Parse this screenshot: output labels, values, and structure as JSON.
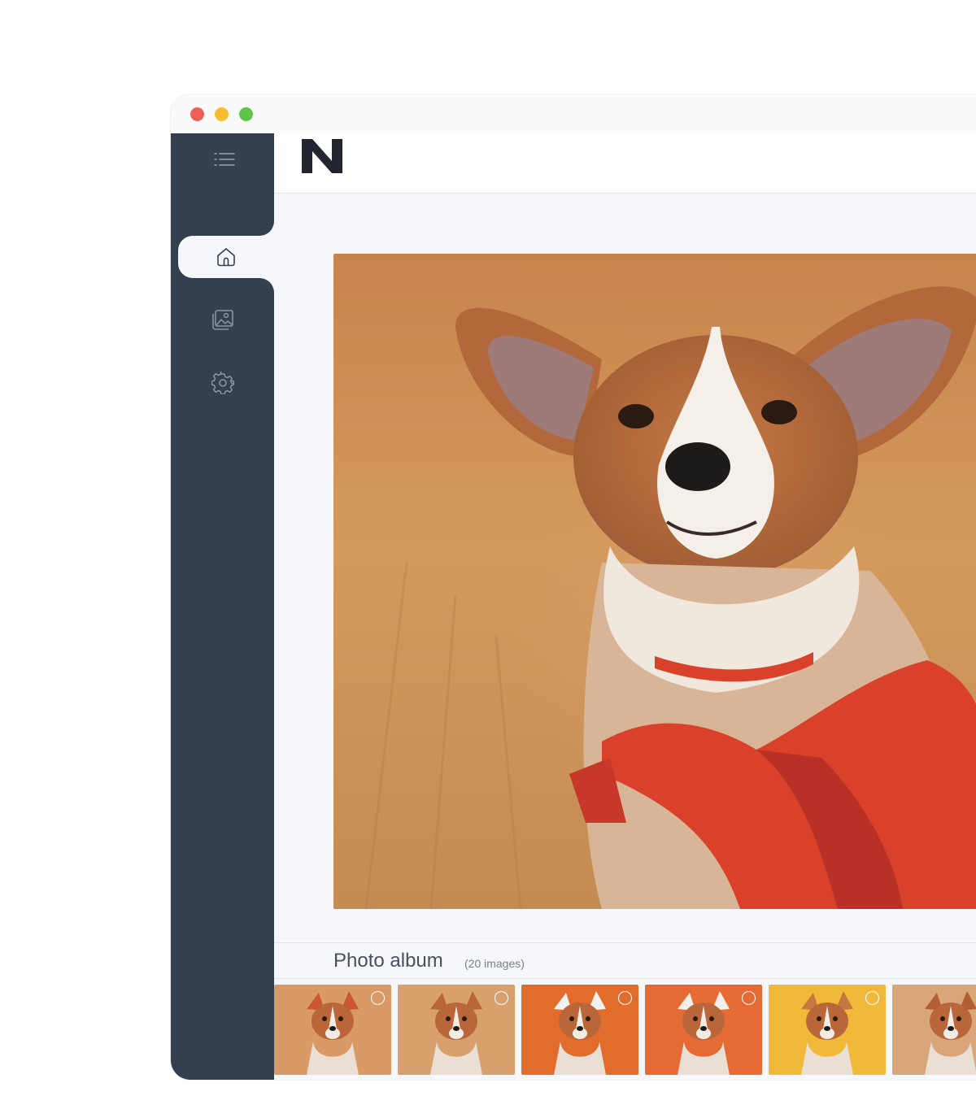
{
  "window": {
    "controls": [
      "close",
      "minimize",
      "maximize"
    ]
  },
  "sidebar": {
    "menu_icon": "list-menu-icon",
    "items": [
      {
        "id": "home",
        "icon": "home-icon",
        "active": true
      },
      {
        "id": "gallery",
        "icon": "gallery-icon",
        "active": false
      },
      {
        "id": "settings",
        "icon": "gear-icon",
        "active": false
      }
    ]
  },
  "header": {
    "logo": "n-logo"
  },
  "album": {
    "title": "Photo album",
    "count": "(20 images)",
    "thumbnails": [
      {
        "bg": "#d99a66",
        "accent": "#c9572f"
      },
      {
        "bg": "#d8a06c",
        "accent": "#b8653a"
      },
      {
        "bg": "#e16c2c",
        "accent": "#f2f1ef"
      },
      {
        "bg": "#e56a33",
        "accent": "#f1efe8"
      },
      {
        "bg": "#f0b93a",
        "accent": "#c4773f"
      },
      {
        "bg": "#d9a679",
        "accent": "#b35f31"
      }
    ]
  },
  "colors": {
    "sidebar": "#343f50",
    "background": "#f5f7fb",
    "accent_red": "#d9412b"
  }
}
